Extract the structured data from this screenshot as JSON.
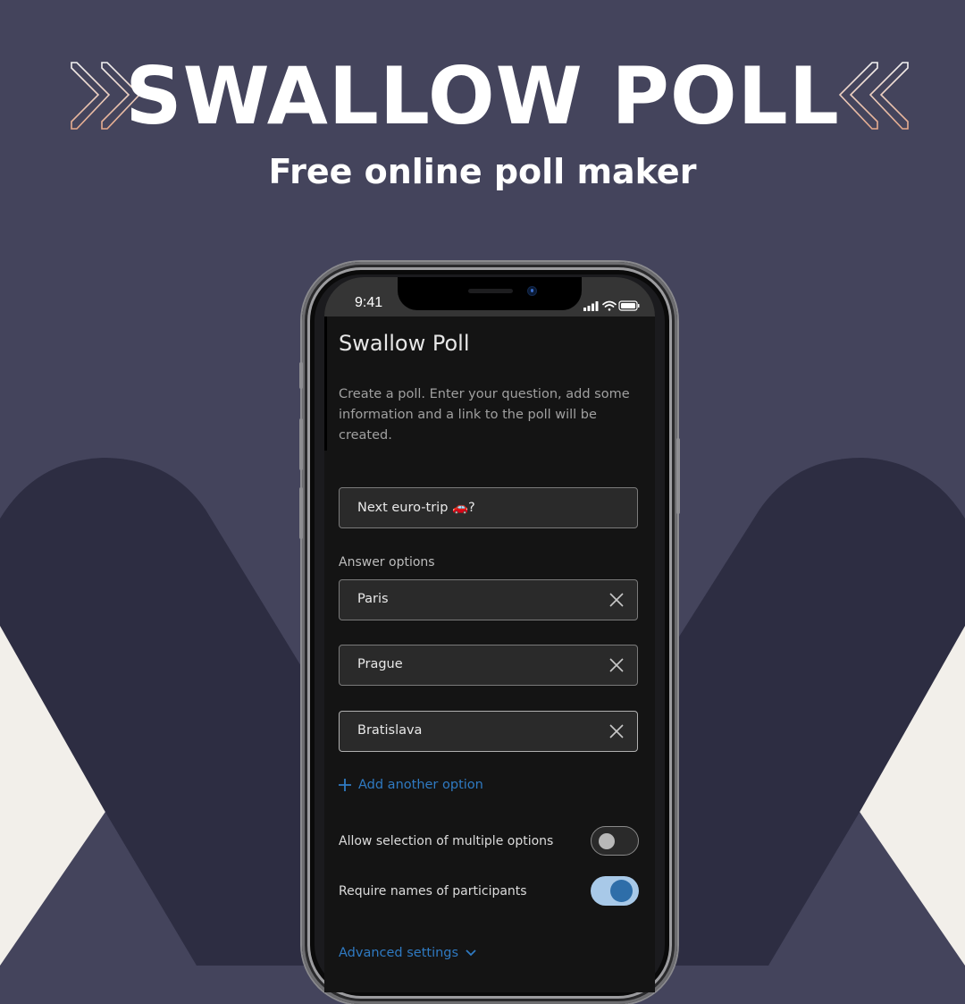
{
  "hero": {
    "title": "SWALLOW POLL",
    "subtitle": "Free online poll maker",
    "left_icon": "double-chevron-right-icon",
    "right_icon": "double-chevron-left-icon"
  },
  "colors": {
    "background": "#44445c",
    "shape_dark": "#2d2d42",
    "shape_light": "#f2efea",
    "accent_blue": "#2f7ac2",
    "toggle_on_track": "#a8c9e8",
    "toggle_on_knob": "#2e6ea9"
  },
  "status_bar": {
    "time": "9:41",
    "icons": [
      "cellular-signal-icon",
      "wifi-icon",
      "battery-icon"
    ]
  },
  "app": {
    "title": "Swallow Poll",
    "description": "Create a poll. Enter your question, add some information and a link to the poll will be created.",
    "question_value": "Next euro-trip 🚗?",
    "answer_options_label": "Answer options",
    "options": [
      {
        "value": "Paris"
      },
      {
        "value": "Prague"
      },
      {
        "value": "Bratislava"
      }
    ],
    "add_option_label": "Add another option",
    "toggles": [
      {
        "label": "Allow selection of multiple options",
        "on": false
      },
      {
        "label": "Require names of participants",
        "on": true
      }
    ],
    "advanced_settings_label": "Advanced settings"
  }
}
